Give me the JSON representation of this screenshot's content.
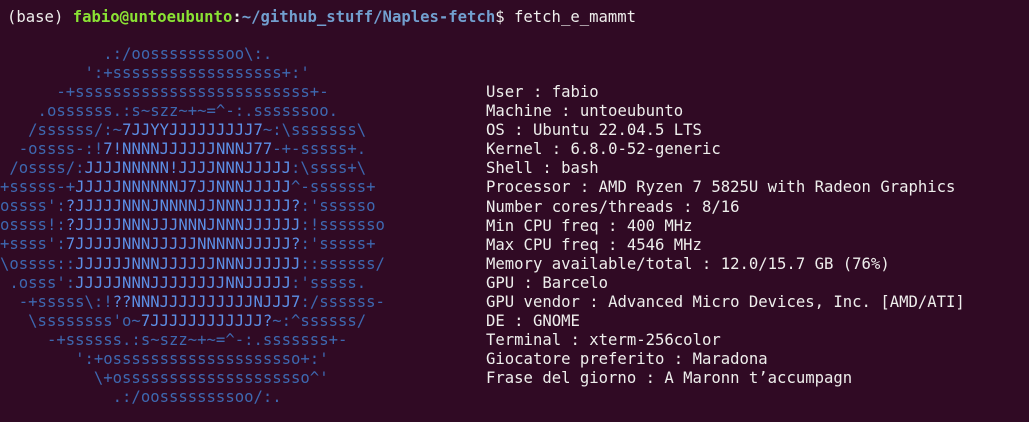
{
  "prompt": {
    "env": "(base)",
    "user_host": "fabio@untoeubunto",
    "colon": ":",
    "path": "~/github_stuff/Naples-fetch",
    "sign": "$",
    "command": "fetch_e_mammt"
  },
  "logo": {
    "lines": [
      [
        [
          "s",
          "           .:/oossssssssoo\\:.          "
        ]
      ],
      [
        [
          "s",
          "         ':+ssssssssssssssssss+:'        "
        ]
      ],
      [
        [
          "s",
          "      -+sssssssssssssssssssssssss+-      "
        ]
      ],
      [
        [
          "s",
          "    .ossssss.:s~szz~+~=^-:.ssssssoo.    "
        ]
      ],
      [
        [
          "s",
          "   /ssssss/:~"
        ],
        [
          "j",
          "7JJYYJJJJJJJJJ7"
        ],
        [
          "s",
          "~:\\sssssss\\   "
        ]
      ],
      [
        [
          "s",
          "  -ossss-:!"
        ],
        [
          "j",
          "7!NNNNJJJJJJNNNJ77"
        ],
        [
          "s",
          "-+-sssss+.  "
        ]
      ],
      [
        [
          "s",
          " /ossss/:"
        ],
        [
          "j",
          "JJJJNNNNN!JJJJNNNJJJJJ"
        ],
        [
          "s",
          ":\\ssss+\\  "
        ]
      ],
      [
        [
          "s",
          "+sssss-+"
        ],
        [
          "j",
          "JJJJJNNNNNNJ7JJNNNJJJJJ"
        ],
        [
          "s",
          "^-ssssss+ "
        ]
      ],
      [
        [
          "s",
          "ossss':"
        ],
        [
          "j",
          "?JJJJJNNNJNNNNJJNNNJJJJJ?"
        ],
        [
          "s",
          ":'ssssso "
        ]
      ],
      [
        [
          "s",
          "ossss!:"
        ],
        [
          "j",
          "?JJJJJNNNJJJNNNJNNNJJJJJJ"
        ],
        [
          "s",
          ":!sssssso"
        ]
      ],
      [
        [
          "s",
          "+ssss':"
        ],
        [
          "j",
          "7JJJJJNNNJJJJJNNNNNJJJJJ?"
        ],
        [
          "s",
          ":'sssss+ "
        ]
      ],
      [
        [
          "s",
          "\\ossss::"
        ],
        [
          "j",
          "JJJJJJNNNJJJJJJNNNJJJJJJ"
        ],
        [
          "s",
          "::ssssss/ "
        ]
      ],
      [
        [
          "s",
          " .osss':"
        ],
        [
          "j",
          "JJJJJNNNJJJJJJJJNNJJJJJ"
        ],
        [
          "s",
          ":'sssss.  "
        ]
      ],
      [
        [
          "s",
          "  -+sssss\\:!"
        ],
        [
          "j",
          "??NNNJJJJJJJJJJNJJJ7"
        ],
        [
          "s",
          ":/ssssss-  "
        ]
      ],
      [
        [
          "s",
          "   \\ssssssss'o~"
        ],
        [
          "j",
          "7JJJJJJJJJJJJ?"
        ],
        [
          "s",
          "~:^ssssss/   "
        ]
      ],
      [
        [
          "s",
          "     -+ssssss.:s~szz~+~=^-:.sssssss+-    "
        ]
      ],
      [
        [
          "s",
          "        ':+ossssssssssssssssssso+:'      "
        ]
      ],
      [
        [
          "s",
          "          \\+ossssssssssssssssssso^'      "
        ]
      ],
      [
        [
          "s",
          "            .:/oossssssssoo/:.          "
        ]
      ]
    ]
  },
  "info": [
    {
      "label": "User",
      "value": "fabio"
    },
    {
      "label": "Machine",
      "value": "untoeubunto"
    },
    {
      "label": "OS",
      "value": "Ubuntu 22.04.5 LTS"
    },
    {
      "label": "Kernel",
      "value": "6.8.0-52-generic"
    },
    {
      "label": "Shell",
      "value": "bash"
    },
    {
      "label": "Processor",
      "value": "AMD Ryzen 7 5825U with Radeon Graphics"
    },
    {
      "label": "Number cores/threads",
      "value": "8/16"
    },
    {
      "label": "Min CPU freq",
      "value": "400 MHz"
    },
    {
      "label": "Max CPU freq",
      "value": "4546 MHz"
    },
    {
      "label": "Memory available/total",
      "value": "12.0/15.7 GB (76%)"
    },
    {
      "label": "GPU",
      "value": "Barcelo"
    },
    {
      "label": "GPU vendor",
      "value": "Advanced Micro Devices, Inc. [AMD/ATI]"
    },
    {
      "label": "DE",
      "value": "GNOME"
    },
    {
      "label": "Terminal",
      "value": "xterm-256color"
    },
    {
      "label": "Giocatore preferito",
      "value": "Maradona"
    },
    {
      "label": "Frase del giorno",
      "value": "A Maronn t’accumpagn"
    }
  ],
  "colors": {
    "background": "#300a24",
    "user_host": "#8ae234",
    "path": "#729fcf",
    "logo_dim": "#3e68b0",
    "logo_bright": "#5c8fe6",
    "text": "#eeeeec"
  }
}
